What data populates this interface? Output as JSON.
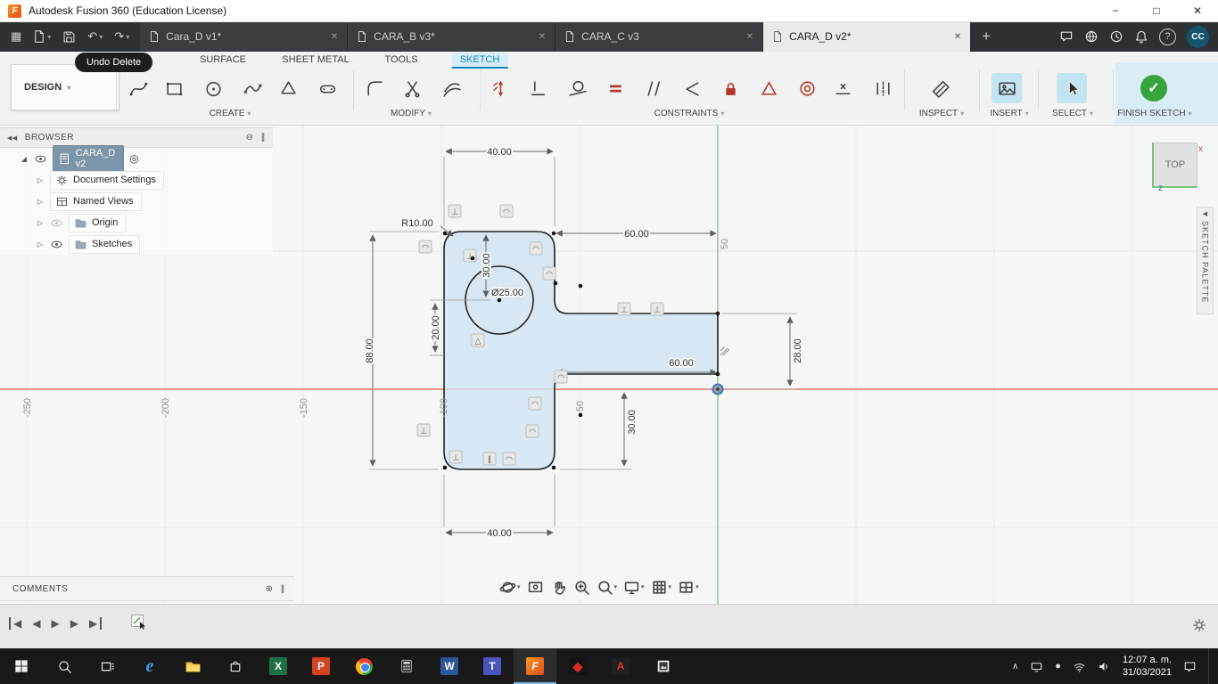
{
  "titlebar": {
    "title": "Autodesk Fusion 360 (Education License)",
    "logo": "F"
  },
  "glyphs": {
    "min": "−",
    "max": "□",
    "close": "✕",
    "caret": "▾",
    "grid": "▦",
    "undo": "↶",
    "redo": "↷",
    "plus": "+",
    "help": "?",
    "check": "✓",
    "collapse_left": "◀◀",
    "collapse": "◀",
    "minus_circle": "⊖",
    "plus_circle": "⊕",
    "dock": "∥",
    "target": "◎",
    "expand_open": "◢",
    "expand": "▷",
    "skip_start": "◀",
    "prev": "◀",
    "play": "▶",
    "next": "▶",
    "skip_end": "▶",
    "chevron_up": "∧",
    "dot": "●",
    "perp": "⊥",
    "arc": "◠",
    "par": "∥",
    "tri": "△"
  },
  "tabbar": {
    "tabs": [
      {
        "label": "Cara_D v1*"
      },
      {
        "label": "CARA_B v3*"
      },
      {
        "label": "CARA_C v3"
      },
      {
        "label": "CARA_D v2*"
      }
    ],
    "avatar": "CC"
  },
  "toast": "Undo Delete",
  "toolbar": {
    "workspace": "DESIGN",
    "menus": [
      {
        "label": "SURFACE"
      },
      {
        "label": "SHEET METAL"
      },
      {
        "label": "TOOLS"
      },
      {
        "label": "SKETCH"
      }
    ],
    "groups": {
      "create": "CREATE",
      "modify": "MODIFY",
      "constraints": "CONSTRAINTS",
      "inspect": "INSPECT",
      "insert": "INSERT",
      "select": "SELECT",
      "finish": "FINISH SKETCH"
    }
  },
  "browser": {
    "title": "BROWSER",
    "root": "CARA_D v2",
    "items": [
      {
        "label": "Document Settings"
      },
      {
        "label": "Named Views"
      },
      {
        "label": "Origin"
      },
      {
        "label": "Sketches"
      }
    ]
  },
  "comments": {
    "title": "COMMENTS"
  },
  "sketch_palette": {
    "title": "SKETCH PALETTE"
  },
  "viewcube": {
    "face": "TOP",
    "x": "x",
    "z": "z"
  },
  "sketch": {
    "dims": {
      "top_width": "40.00",
      "fillet": "R10.00",
      "tab_offset_top": "60.00",
      "height": "88.00",
      "circle_top": "30.00",
      "circle_dia": "Ø25.00",
      "circle_left": "20.00",
      "tab_length": "60.00",
      "tab_height": "28.00",
      "bottom_offset": "30.00",
      "bottom_width": "40.00"
    },
    "grid_x": [
      "-250",
      "-200",
      "-150",
      "-100",
      "-50"
    ],
    "grid_y": "50"
  },
  "taskbar": {
    "apps": {
      "edge": "e",
      "excel": "X",
      "powerpoint": "P",
      "word": "W",
      "teams": "T",
      "fusion": "F",
      "acrobat": "A"
    },
    "time": "12:07 a. m.",
    "date": "31/03/2021"
  }
}
